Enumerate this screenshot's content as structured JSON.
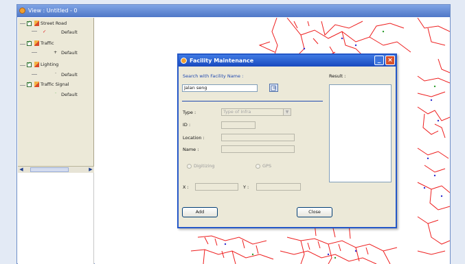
{
  "window": {
    "title": "View : Untitled - 0"
  },
  "layers": [
    {
      "name": "Street Road",
      "style": "Default"
    },
    {
      "name": "Traffic",
      "style": "Default"
    },
    {
      "name": "Lighting",
      "style": "Default"
    },
    {
      "name": "Traffic Signal",
      "style": "Default"
    }
  ],
  "dialog": {
    "title": "Facility Maintenance",
    "search_label": "Search with Facility Name :",
    "search_value": "Jalan seng",
    "result_label": "Result :",
    "type_label": "Type :",
    "type_value": "Type of Infra",
    "id_label": "ID :",
    "location_label": "Location :",
    "name_label": "Name :",
    "digitizing_label": "Digitizing",
    "gps_label": "GPS",
    "x_label": "X :",
    "y_label": "Y :",
    "add_label": "Add",
    "close_label": "Close"
  },
  "colors": {
    "map_roads": "#ee1c1c",
    "title_bar": "#2457c8",
    "panel_bg": "#ece9d8"
  }
}
